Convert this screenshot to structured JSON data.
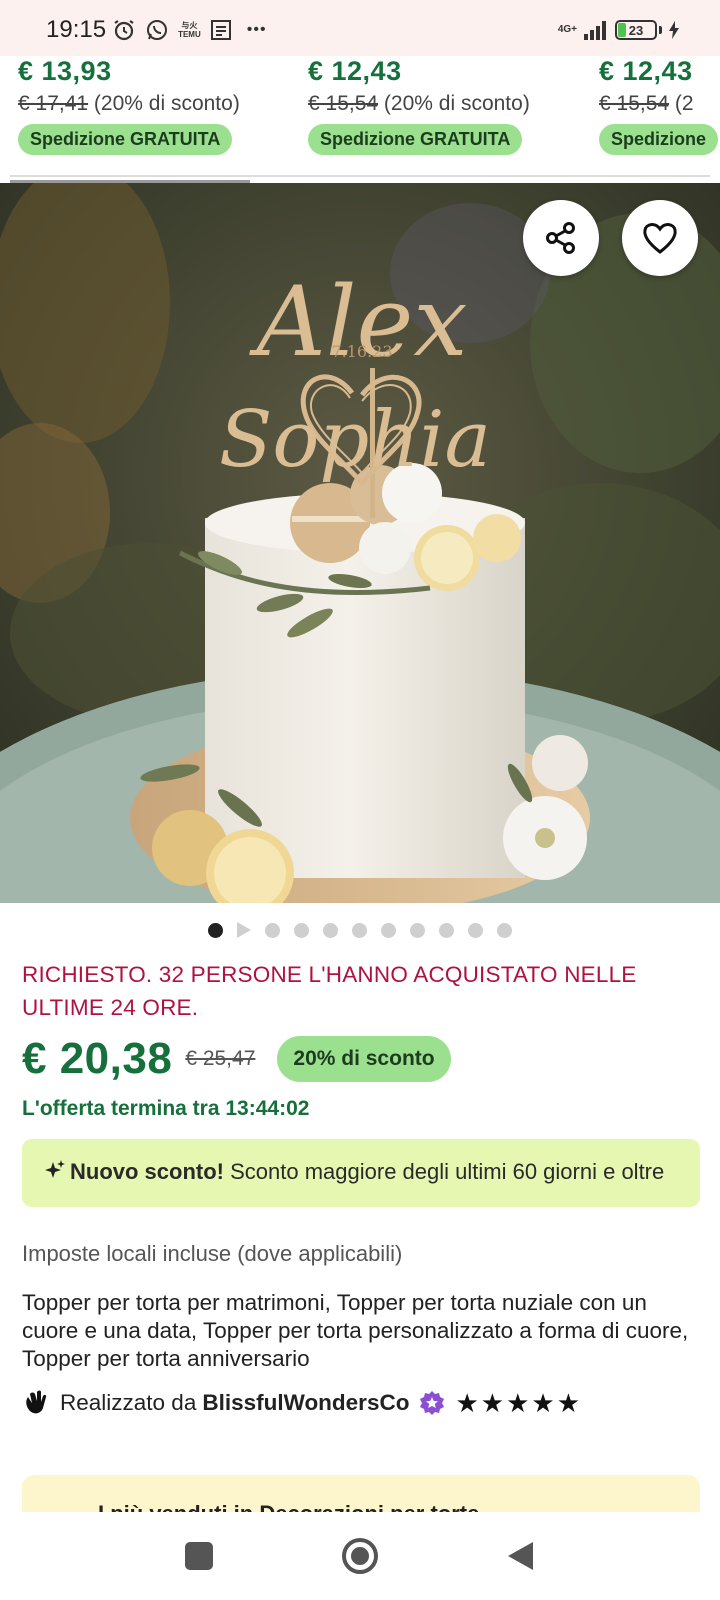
{
  "status_bar": {
    "time": "19:15",
    "temu_label_top": "与火",
    "temu_label_bottom": "TEMU",
    "more": "•••",
    "network": "4G+",
    "battery": "23"
  },
  "related": [
    {
      "price": "€ 13,93",
      "old_price": "€ 17,41",
      "discount": " (20% di sconto)",
      "shipping": "Spedizione GRATUITA"
    },
    {
      "price": "€ 12,43",
      "old_price": "€ 15,54",
      "discount": " (20% di sconto)",
      "shipping": "Spedizione GRATUITA"
    },
    {
      "price": "€ 12,43",
      "old_price": "€ 15,54",
      "discount": " (2",
      "shipping": "Spedizione"
    }
  ],
  "hero": {
    "topper_name_1": "Alex",
    "topper_date": "7.16.23",
    "topper_name_2": "Sophia",
    "share_icon": "share-icon",
    "favorite_icon": "heart-icon"
  },
  "carousel": {
    "total_dots": 11,
    "active_index": 0
  },
  "product": {
    "demand_text": "RICHIESTO. 32 PERSONE L'HANNO ACQUISTATO NELLE ULTIME 24 ORE.",
    "price": "€ 20,38",
    "old_price": "€ 25,47",
    "discount_badge": "20% di sconto",
    "offer_ends": "L'offerta termina tra 13:44:02",
    "promo_bold": "Nuovo sconto!",
    "promo_text": " Sconto maggiore degli ultimi 60 giorni e oltre",
    "taxes": "Imposte locali incluse (dove applicabili)",
    "title": "Topper per torta per matrimoni, Topper per torta nuziale con un cuore e una data, Topper per torta personalizzato a forma di cuore, Topper per torta anniversario",
    "made_by_label": "Realizzato da",
    "shop_name": "BlissfulWondersCo",
    "rating_stars": 5,
    "bestseller_text": "I più venduti in Decorazioni per torte"
  },
  "colors": {
    "price_green": "#16703b",
    "badge_green": "#9be08f",
    "demand_red": "#b0123f",
    "promo_bg": "#e6f7b1",
    "star_seller_purple": "#8a4fd3"
  }
}
